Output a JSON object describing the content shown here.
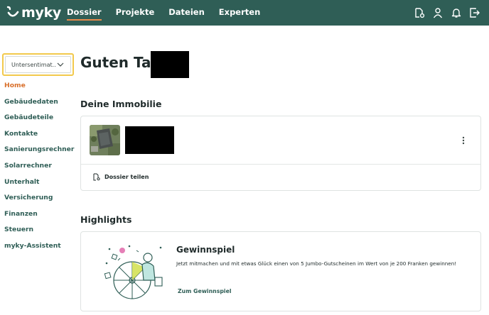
{
  "brand": {
    "name": "myky",
    "color": "#2f5e56",
    "accent": "#e88a4a"
  },
  "nav": {
    "items": [
      {
        "label": "Dossier",
        "active": true
      },
      {
        "label": "Projekte"
      },
      {
        "label": "Dateien"
      },
      {
        "label": "Experten"
      }
    ]
  },
  "top_icons": [
    "dossier-share-icon",
    "user-icon",
    "bell-icon",
    "logout-icon"
  ],
  "selector": {
    "value": "Untersentimat..."
  },
  "sidebar": {
    "items": [
      {
        "label": "Home",
        "active": true
      },
      {
        "label": "Gebäudedaten"
      },
      {
        "label": "Gebäudeteile"
      },
      {
        "label": "Kontakte"
      },
      {
        "label": "Sanierungsrechner"
      },
      {
        "label": "Solarrechner"
      },
      {
        "label": "Unterhalt"
      },
      {
        "label": "Versicherung"
      },
      {
        "label": "Finanzen"
      },
      {
        "label": "Steuern"
      },
      {
        "label": "myky-Assistent"
      }
    ]
  },
  "main": {
    "greeting": "Guten Tag",
    "property_section": {
      "heading": "Deine Immobilie",
      "share_label": "Dossier teilen"
    },
    "highlights": {
      "heading": "Highlights",
      "card": {
        "title": "Gewinnspiel",
        "text": "Jetzt mitmachen und mit etwas Glück einen von 5 Jumbo-Gutscheinen im Wert von je 200 Franken gewinnen!",
        "link": "Zum Gewinnspiel"
      }
    }
  }
}
